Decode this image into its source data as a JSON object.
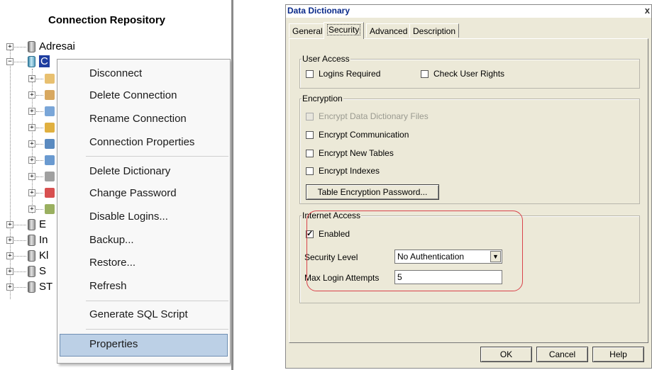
{
  "repository": {
    "title": "Connection Repository",
    "nodes": [
      {
        "label": "Adresai"
      },
      {
        "label": "C"
      },
      {
        "label": "E"
      },
      {
        "label": "In"
      },
      {
        "label": "Kl"
      },
      {
        "label": "S"
      },
      {
        "label": "ST"
      }
    ]
  },
  "context_menu": {
    "items": [
      "Disconnect",
      "Delete Connection",
      "Rename Connection",
      "Connection Properties",
      "Delete Dictionary",
      "Change Password",
      "Disable Logins...",
      "Backup...",
      "Restore...",
      "Refresh",
      "Generate SQL Script",
      "Properties"
    ],
    "highlighted": "Properties"
  },
  "dialog": {
    "title": "Data Dictionary",
    "close": "x",
    "tabs": [
      "General",
      "Security",
      "Advanced",
      "Description"
    ],
    "active_tab": "Security",
    "user_access": {
      "legend": "User Access",
      "logins_required": "Logins Required",
      "check_user_rights": "Check User Rights"
    },
    "encryption": {
      "legend": "Encryption",
      "encrypt_dd_files": "Encrypt Data Dictionary Files",
      "encrypt_communication": "Encrypt Communication",
      "encrypt_new_tables": "Encrypt New Tables",
      "encrypt_indexes": "Encrypt Indexes",
      "table_encryption_password": "Table Encryption Password..."
    },
    "internet_access": {
      "legend": "Internet Access",
      "enabled": "Enabled",
      "enabled_checked": true,
      "security_level_label": "Security Level",
      "security_level_value": "No Authentication",
      "max_login_label": "Max Login Attempts",
      "max_login_value": "5"
    },
    "buttons": {
      "ok": "OK",
      "cancel": "Cancel",
      "help": "Help"
    }
  },
  "colors": {
    "highlight_ring": "#d9434b",
    "selection": "#1f3ea0",
    "menu_hover": "#bcd0e6"
  }
}
